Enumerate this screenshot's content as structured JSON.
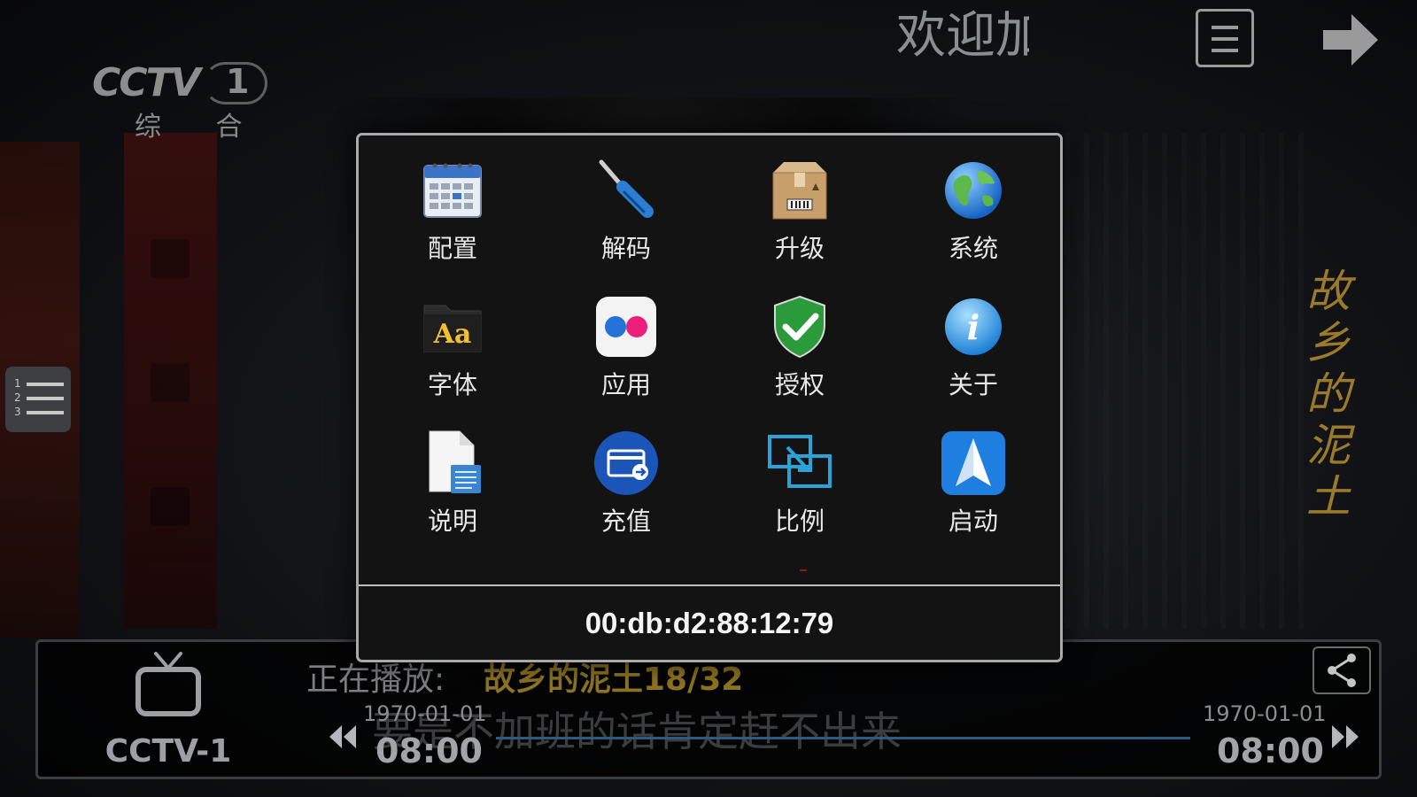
{
  "header": {
    "welcome_text": "欢迎加",
    "menu_icon": "hamburger-menu-icon",
    "forward_icon": "arrow-right-icon"
  },
  "channel_logo": {
    "brand": "CCTV",
    "number": "1",
    "subtitle": "综 合"
  },
  "sidebar": {
    "list_button_icon": "numbered-list-icon",
    "list_numbers": [
      "1",
      "2",
      "3"
    ]
  },
  "drama_title_vertical": [
    "故",
    "乡",
    "的",
    "泥",
    "土"
  ],
  "dialog": {
    "items": [
      {
        "label": "配置",
        "icon": "calendar-icon"
      },
      {
        "label": "解码",
        "icon": "screwdriver-icon"
      },
      {
        "label": "升级",
        "icon": "package-box-icon"
      },
      {
        "label": "系统",
        "icon": "globe-icon"
      },
      {
        "label": "字体",
        "icon": "font-folder-icon"
      },
      {
        "label": "应用",
        "icon": "flickr-dots-icon"
      },
      {
        "label": "授权",
        "icon": "shield-check-icon"
      },
      {
        "label": "关于",
        "icon": "info-icon"
      },
      {
        "label": "说明",
        "icon": "document-icon"
      },
      {
        "label": "充值",
        "icon": "payment-card-icon"
      },
      {
        "label": "比例",
        "icon": "aspect-ratio-icon"
      },
      {
        "label": "启动",
        "icon": "paper-plane-icon"
      }
    ],
    "mac_address": "00:db:d2:88:12:79"
  },
  "info_bar": {
    "channel_icon": "tv-icon",
    "channel_name": "CCTV-1",
    "now_playing_label": "正在播放:",
    "now_playing_title": "故乡的泥土18/32",
    "subtitle": "要是不加班的话肯定赶不出来",
    "start_date": "1970-01-01",
    "start_time": "08:00",
    "end_date": "1970-01-01",
    "end_time": "08:00",
    "progress_fraction": 1.0,
    "prev_icon": "rewind-icon",
    "next_icon": "fast-forward-icon",
    "share_icon": "share-icon"
  },
  "colors": {
    "dialog_border": "#a9a9a9",
    "dialog_bg": "#131313",
    "title_gold": "#8f7420"
  }
}
